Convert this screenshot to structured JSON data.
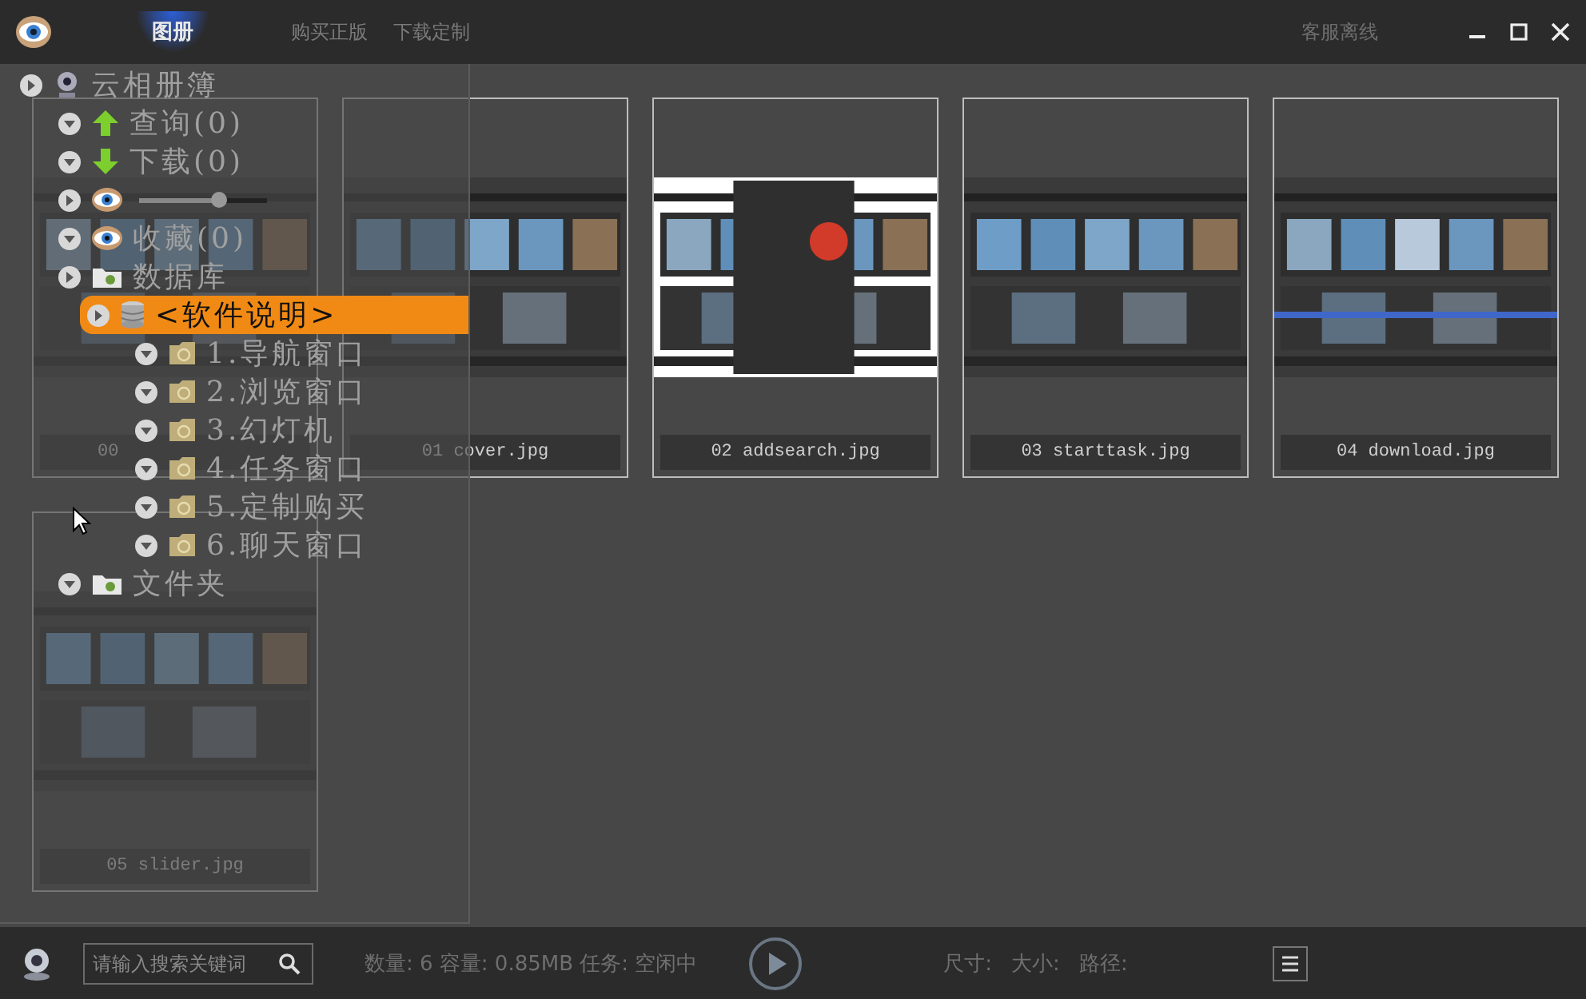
{
  "window": {
    "tabs": [
      {
        "label": "图册",
        "selected": true
      },
      {
        "label": "购买正版",
        "selected": false
      },
      {
        "label": "下载定制",
        "selected": false
      }
    ],
    "service_status": "客服离线"
  },
  "gallery": {
    "items": [
      {
        "caption": "00"
      },
      {
        "caption": "01 cover.jpg"
      },
      {
        "caption": "02 addsearch.jpg"
      },
      {
        "caption": "03 starttask.jpg"
      },
      {
        "caption": "04 download.jpg"
      },
      {
        "caption": "05 slider.jpg"
      }
    ]
  },
  "tree": [
    {
      "label": "云相册簿",
      "kind": "root",
      "expanded": false,
      "selected": false,
      "children": [
        {
          "label": "查询(0)",
          "kind": "query",
          "expanded": true,
          "selected": false
        },
        {
          "label": "下载(0)",
          "kind": "download",
          "expanded": true,
          "selected": false
        },
        {
          "kind": "zoom",
          "level": 0.62,
          "expanded": false,
          "selected": false
        },
        {
          "label": "收藏(0)",
          "kind": "favorites",
          "expanded": true,
          "selected": false
        },
        {
          "label": "数据库",
          "kind": "database",
          "expanded": false,
          "selected": false,
          "children": [
            {
              "label": "<软件说明>",
              "kind": "manual",
              "expanded": false,
              "selected": true,
              "children": [
                {
                  "label": "1.导航窗口",
                  "kind": "section",
                  "expanded": true,
                  "selected": false
                },
                {
                  "label": "2.浏览窗口",
                  "kind": "section",
                  "expanded": true,
                  "selected": false
                },
                {
                  "label": "3.幻灯机",
                  "kind": "section",
                  "expanded": true,
                  "selected": false
                },
                {
                  "label": "4.任务窗口",
                  "kind": "section",
                  "expanded": true,
                  "selected": false
                },
                {
                  "label": "5.定制购买",
                  "kind": "section",
                  "expanded": true,
                  "selected": false
                },
                {
                  "label": "6.聊天窗口",
                  "kind": "section",
                  "expanded": true,
                  "selected": false
                }
              ]
            }
          ]
        },
        {
          "label": "文件夹",
          "kind": "folders",
          "expanded": true,
          "selected": false
        }
      ]
    }
  ],
  "status_bar": {
    "search": {
      "placeholder": "请输入搜索关键词"
    },
    "summary": "数量: 6 容量: 0.85MB 任务: 空闲中",
    "details": [
      "尺寸:",
      "大小:",
      "路径:"
    ]
  }
}
